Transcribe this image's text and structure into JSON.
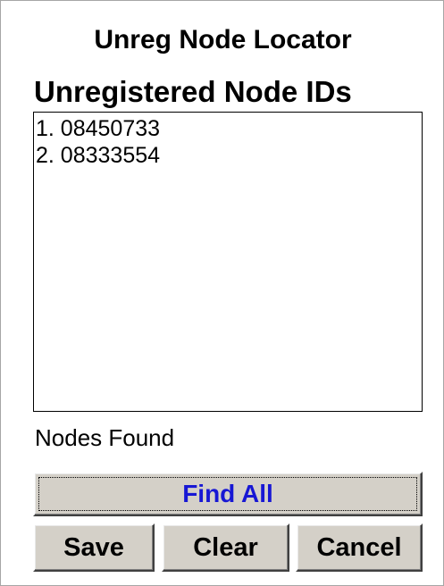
{
  "window": {
    "title": "Unreg Node Locator"
  },
  "list": {
    "heading": "Unregistered Node IDs",
    "items": [
      "1. 08450733",
      "2. 08333554"
    ]
  },
  "status": {
    "label": "Nodes Found"
  },
  "buttons": {
    "find_all": "Find All",
    "save": "Save",
    "clear": "Clear",
    "cancel": "Cancel"
  },
  "colors": {
    "find_all_text": "#1717d4",
    "button_face": "#d4d0c8"
  }
}
